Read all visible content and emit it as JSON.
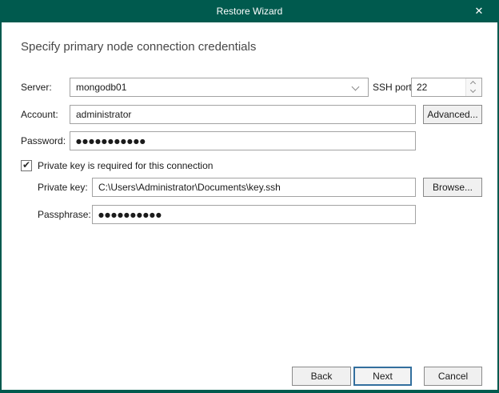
{
  "window": {
    "title": "Restore Wizard",
    "close_glyph": "✕"
  },
  "heading": "Specify primary node connection credentials",
  "form": {
    "server": {
      "label": "Server:",
      "value": "mongodb01"
    },
    "ssh_port": {
      "label": "SSH port:",
      "value": "22"
    },
    "account": {
      "label": "Account:",
      "value": "administrator"
    },
    "advanced_button": "Advanced...",
    "password": {
      "label": "Password:",
      "masked_value": "●●●●●●●●●●●"
    },
    "private_key_option": {
      "label": "Private key is required for this connection",
      "checked": true,
      "check_glyph": "✔"
    },
    "private_key": {
      "label": "Private key:",
      "value": "C:\\Users\\Administrator\\Documents\\key.ssh"
    },
    "browse_button": "Browse...",
    "passphrase": {
      "label": "Passphrase:",
      "masked_value": "●●●●●●●●●●"
    }
  },
  "footer": {
    "back_label": "Back",
    "next_label": "Next",
    "cancel_label": "Cancel"
  },
  "colors": {
    "titlebar_teal": "#005A4E",
    "focus_blue": "#336F9E"
  }
}
